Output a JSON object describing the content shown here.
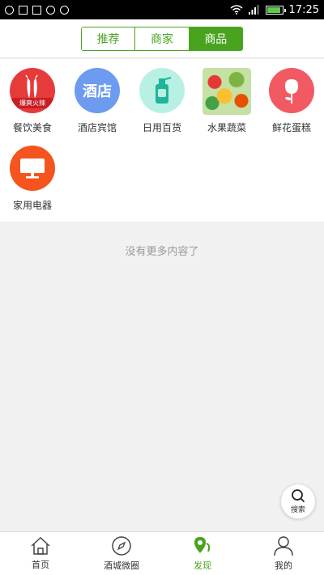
{
  "statusbar": {
    "time": "17:25"
  },
  "tabs": [
    {
      "label": "推荐",
      "active": false
    },
    {
      "label": "商家",
      "active": false
    },
    {
      "label": "商品",
      "active": true
    }
  ],
  "categories": [
    {
      "label": "餐饮美食",
      "icon": "chili-pepper-icon",
      "badge": "爆爽火辣",
      "color": "#e53b3b"
    },
    {
      "label": "酒店宾馆",
      "icon": "hotel-icon",
      "icon_text": "酒店",
      "color": "#6c9bef"
    },
    {
      "label": "日用百货",
      "icon": "spray-bottle-icon",
      "color": "#b9f0e4"
    },
    {
      "label": "水果蔬菜",
      "icon": "vegetables-image",
      "color": "#c5e1a5"
    },
    {
      "label": "鲜花蛋糕",
      "icon": "flower-icon",
      "color": "#f15a63"
    },
    {
      "label": "家用电器",
      "icon": "monitor-icon",
      "color": "#f5541e"
    }
  ],
  "empty_message": "没有更多内容了",
  "fab": {
    "label": "搜索",
    "icon": "search-icon"
  },
  "bottom_nav": [
    {
      "label": "首页",
      "icon": "home-icon",
      "active": false
    },
    {
      "label": "酒城微圈",
      "icon": "compass-icon",
      "active": false
    },
    {
      "label": "发现",
      "icon": "location-pin-icon",
      "active": true
    },
    {
      "label": "我的",
      "icon": "user-icon",
      "active": false
    }
  ],
  "colors": {
    "accent": "#4aa31f",
    "background": "#f1f1f1"
  }
}
